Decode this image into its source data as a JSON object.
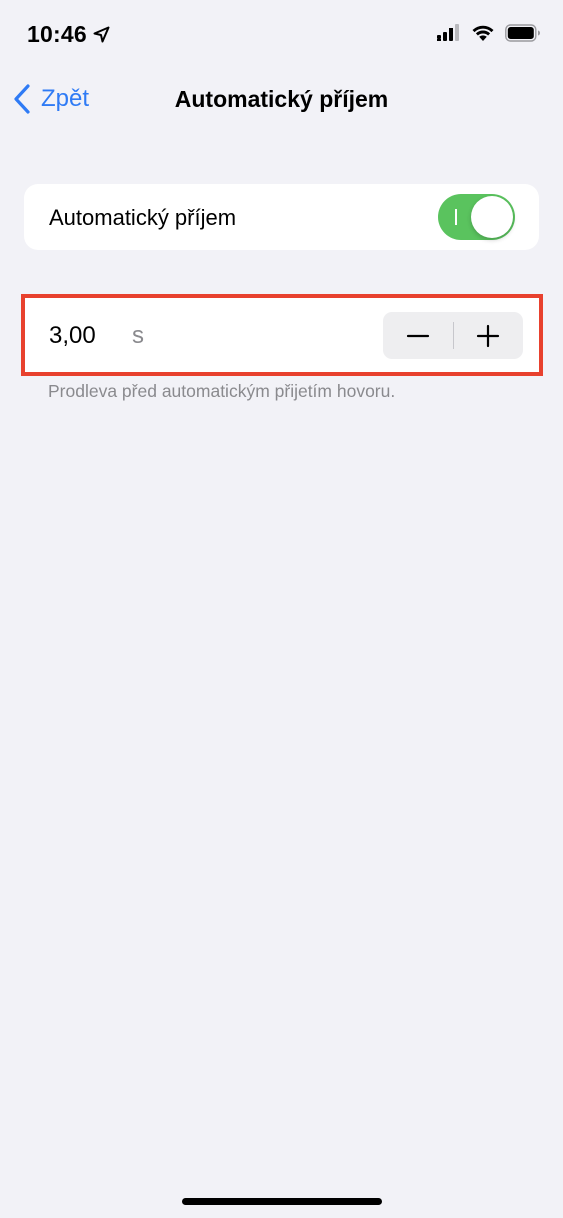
{
  "status_bar": {
    "time": "10:46",
    "location_icon": "location-arrow-icon",
    "signal_icon": "cellular-signal-icon",
    "wifi_icon": "wifi-icon",
    "battery_icon": "battery-icon"
  },
  "nav": {
    "back_label": "Zpět",
    "back_icon": "chevron-left-icon",
    "title": "Automatický příjem"
  },
  "auto_answer": {
    "label": "Automatický příjem",
    "enabled": true
  },
  "delay": {
    "value": "3,00",
    "unit": "s",
    "decrement_icon": "minus-icon",
    "increment_icon": "plus-icon",
    "footnote": "Prodleva před automatickým přijetím hovoru."
  },
  "colors": {
    "accent": "#2f7bf5",
    "toggle_on": "#5ac35e",
    "highlight": "#e8412e",
    "background": "#f2f2f7"
  }
}
